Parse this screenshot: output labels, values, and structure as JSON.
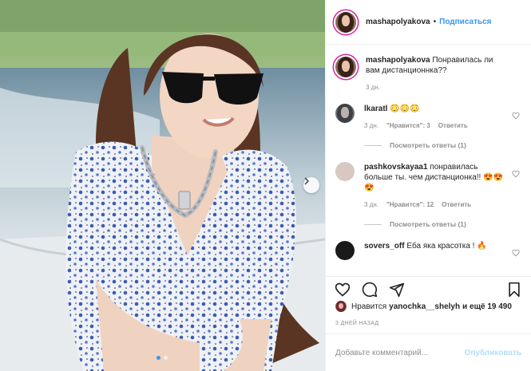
{
  "post": {
    "author": "mashapolyakova",
    "follow_label": "Подписаться",
    "bullet": "•",
    "caption": "Понравилась ли вам дистанционнка??",
    "caption_time": "3 дн."
  },
  "comments": [
    {
      "username": "lkaratl",
      "text": "😳😳😳",
      "time": "3 дн.",
      "likes": "\"Нравится\": 3",
      "reply": "Ответить",
      "view_replies": "Посмотреть ответы (1)"
    },
    {
      "username": "pashkovskayaa1",
      "text": "понравилась больше ты. чем дистанционка!! 😍😍😍",
      "time": "3 дн.",
      "likes": "\"Нравится\": 12",
      "reply": "Ответить",
      "view_replies": "Посмотреть ответы (1)"
    },
    {
      "username": "sovers_off",
      "text": "Еба яка красотка ! 🔥",
      "time": "",
      "likes": "",
      "reply": "",
      "view_replies": ""
    }
  ],
  "likes_line": {
    "prefix": "Нравится",
    "user": "yanochka__shelyh",
    "suffix": "и ещё 19 490"
  },
  "date_label": "3 ДНЕЙ НАЗАД",
  "add_comment": {
    "placeholder": "Добавьте комментарий...",
    "publish_label": "Опубликовать"
  },
  "icons": {
    "like": "heart-icon",
    "comment": "comment-icon",
    "share": "share-icon",
    "save": "bookmark-icon",
    "next": "chevron-right-icon"
  },
  "colors": {
    "link_blue": "#3897f0",
    "muted": "#8e8e8e",
    "publish_disabled": "#b2dffc",
    "text": "#262626"
  },
  "carousel": {
    "slides": 2,
    "active": 1
  }
}
